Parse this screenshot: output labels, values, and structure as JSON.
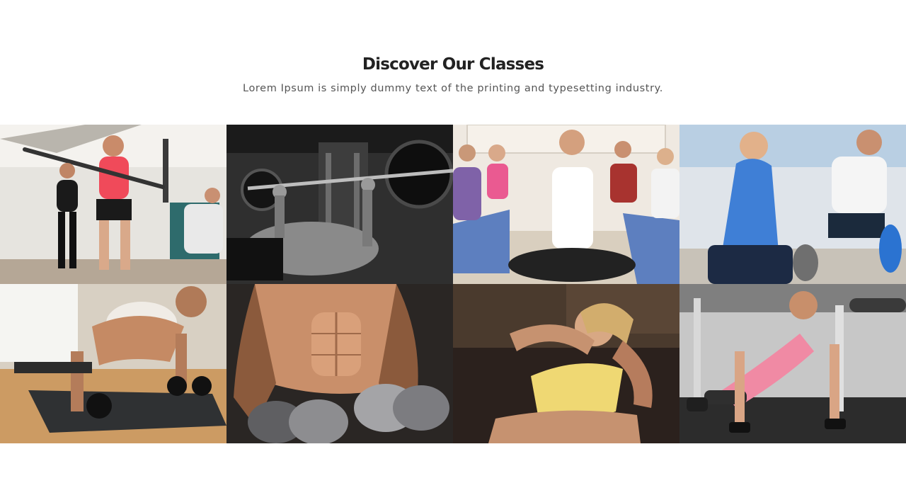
{
  "section": {
    "title": "Discover Our Classes",
    "subtitle": "Lorem Ipsum is simply dummy text of the printing and typesetting industry."
  },
  "gallery": {
    "tiles": [
      {
        "photo": "group-fitness-bar-squat-photo",
        "palette": [
          "#e8e6e2",
          "#f04a5a",
          "#1a1a1a",
          "#d9a98a"
        ]
      },
      {
        "photo": "bench-press-barbell-photo",
        "palette": [
          "#2b2b2b",
          "#111111",
          "#9a9a9a",
          "#5e5e5e"
        ]
      },
      {
        "photo": "yoga-class-meditation-photo",
        "palette": [
          "#f1ece4",
          "#5d7fbf",
          "#ffffff",
          "#2a2a2a"
        ]
      },
      {
        "photo": "couple-stretching-photo",
        "palette": [
          "#dfe4ea",
          "#3f7fd6",
          "#1c2a44",
          "#e3b48e"
        ]
      },
      {
        "photo": "dumbbell-pushup-woman-photo",
        "palette": [
          "#d0a16b",
          "#2f3133",
          "#f0ece6",
          "#8c6a4a"
        ]
      },
      {
        "photo": "muscular-man-dumbbells-photo",
        "palette": [
          "#2a2624",
          "#c98f6a",
          "#8d8d90",
          "#3b3b3b"
        ]
      },
      {
        "photo": "crunch-exercise-woman-photo",
        "palette": [
          "#2b211d",
          "#efd873",
          "#c69270",
          "#4a3a2d"
        ]
      },
      {
        "photo": "pushup-gym-woman-photo",
        "palette": [
          "#c7c7c7",
          "#f08aa4",
          "#2c2c2c",
          "#d9a585"
        ]
      }
    ]
  }
}
